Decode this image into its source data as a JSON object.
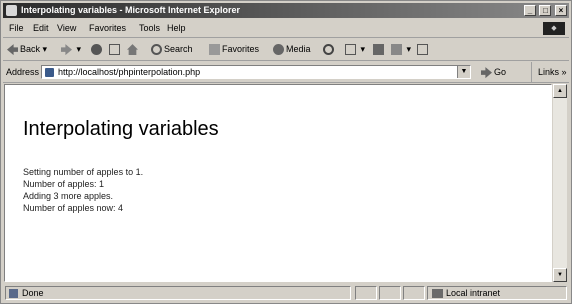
{
  "window": {
    "title": "Interpolating variables - Microsoft Internet Explorer",
    "controls": [
      "_",
      "□",
      "×"
    ]
  },
  "menu": [
    "File",
    "Edit",
    "View",
    "Favorites",
    "Tools",
    "Help"
  ],
  "toolbar": {
    "back": "Back",
    "search": "Search",
    "favorites": "Favorites",
    "media": "Media"
  },
  "address": {
    "label": "Address",
    "url": "http://localhost/phpinterpolation.php",
    "go": "Go",
    "links": "Links »"
  },
  "page": {
    "heading": "Interpolating variables",
    "lines": [
      "Setting number of apples to 1.",
      "Number of apples: 1",
      "Adding 3 more apples.",
      "Number of apples now: 4"
    ]
  },
  "status": {
    "text": "Done",
    "zone": "Local intranet"
  }
}
